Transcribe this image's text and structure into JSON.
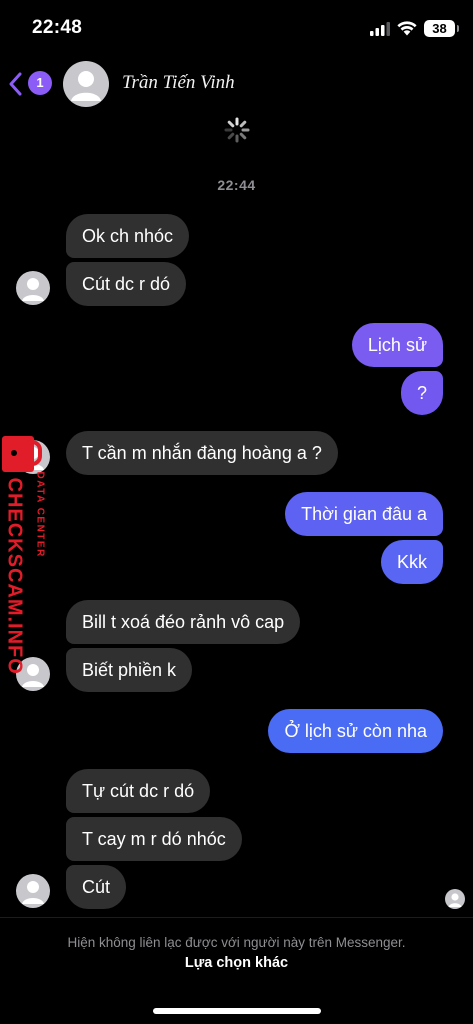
{
  "status_bar": {
    "time": "22:48",
    "battery": "38"
  },
  "header": {
    "back_badge": "1",
    "contact_name": "Trần Tiến Vinh"
  },
  "conversation": {
    "timestamp": "22:44",
    "messages": [
      {
        "direction": "in",
        "text": "Ok ch nhóc"
      },
      {
        "direction": "in",
        "text": "Cút dc r dó"
      },
      {
        "direction": "out",
        "text": "Lịch sử"
      },
      {
        "direction": "out",
        "text": "?"
      },
      {
        "direction": "in",
        "text": "T cần m nhắn đàng hoàng a ?"
      },
      {
        "direction": "out",
        "text": "Thời gian đâu a"
      },
      {
        "direction": "out",
        "text": "Kkk"
      },
      {
        "direction": "in",
        "text": "Bill t xoá đéo rảnh vô cap"
      },
      {
        "direction": "in",
        "text": "Biết phiền k"
      },
      {
        "direction": "out",
        "text": "Ở lịch sử còn nha"
      },
      {
        "direction": "in",
        "text": "Tự cút dc r dó"
      },
      {
        "direction": "in",
        "text": "T cay m r dó nhóc"
      },
      {
        "direction": "in",
        "text": "Cút"
      }
    ]
  },
  "watermark": {
    "main": "CHECKSCAM.INFO",
    "sub": "DATA CENTER"
  },
  "footer": {
    "notice": "Hiện không liên lạc được với người này trên Messenger.",
    "action": "Lựa chọn khác"
  },
  "colors": {
    "background": "#000000",
    "incoming_bubble": "#303030",
    "outgoing_top": "#7b5cf0",
    "outgoing_bottom": "#4a6cf5",
    "accent": "#8b5cf6"
  },
  "icons": [
    "back-chevron-icon",
    "signal-icon",
    "wifi-icon",
    "battery-icon",
    "loading-spinner-icon",
    "avatar-placeholder-icon",
    "lock-icon"
  ]
}
